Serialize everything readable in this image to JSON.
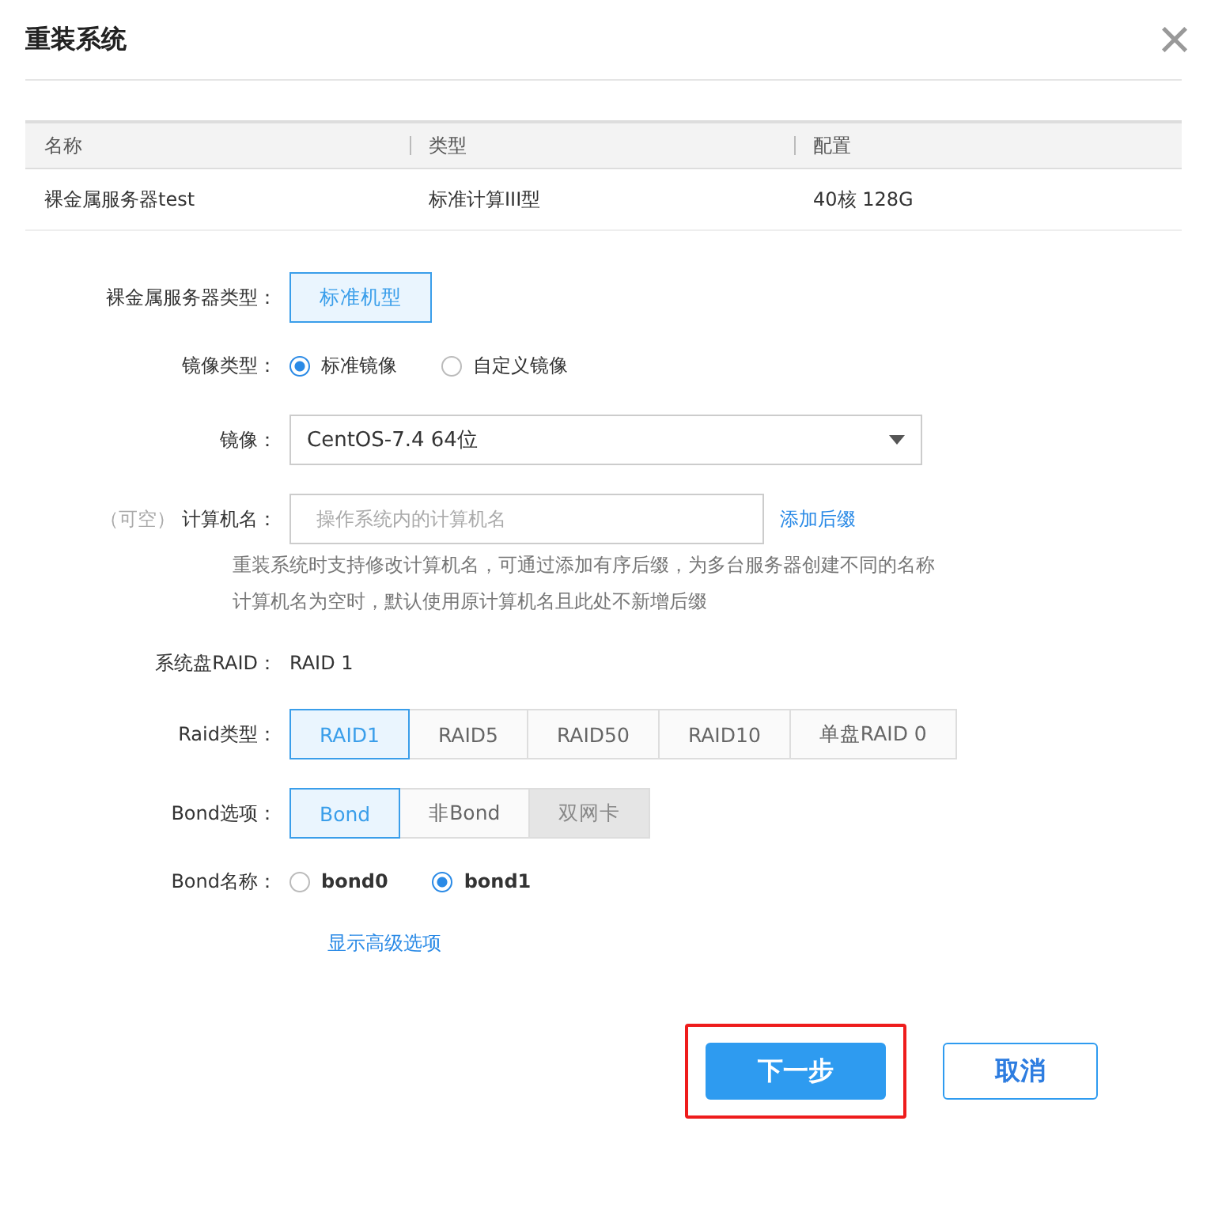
{
  "dialog": {
    "title": "重装系统",
    "close_icon": "×"
  },
  "table": {
    "columns": [
      "名称",
      "类型",
      "配置"
    ],
    "rows": [
      [
        "裸金属服务器test",
        "标准计算III型",
        "40核 128G"
      ]
    ]
  },
  "form": [
    {
      "kind": "buttons",
      "label": "裸金属服务器类型：",
      "options": [
        {
          "label": "标准机型",
          "selected": true,
          "disabled": false
        }
      ]
    },
    {
      "kind": "radios",
      "label": "镜像类型：",
      "bold": false,
      "options": [
        {
          "label": "标准镜像",
          "selected": true
        },
        {
          "label": "自定义镜像",
          "selected": false
        }
      ]
    },
    {
      "kind": "select",
      "label": "镜像：",
      "value": "CentOS-7.4 64位"
    },
    {
      "kind": "input",
      "optional": "（可空）",
      "label": "计算机名：",
      "placeholder": "操作系统内的计算机名",
      "link": "添加后缀",
      "help": [
        "重装系统时支持修改计算机名，可通过添加有序后缀，为多台服务器创建不同的名称",
        "计算机名为空时，默认使用原计算机名且此处不新增后缀"
      ]
    },
    {
      "kind": "text",
      "label": "系统盘RAID：",
      "value": "RAID 1"
    },
    {
      "kind": "buttons",
      "label": "Raid类型：",
      "options": [
        {
          "label": "RAID1",
          "selected": true,
          "disabled": false
        },
        {
          "label": "RAID5",
          "selected": false,
          "disabled": false
        },
        {
          "label": "RAID50",
          "selected": false,
          "disabled": false
        },
        {
          "label": "RAID10",
          "selected": false,
          "disabled": false
        },
        {
          "label": "单盘RAID 0",
          "selected": false,
          "disabled": false
        }
      ]
    },
    {
      "kind": "buttons",
      "label": "Bond选项：",
      "options": [
        {
          "label": "Bond",
          "selected": true,
          "disabled": false
        },
        {
          "label": "非Bond",
          "selected": false,
          "disabled": false
        },
        {
          "label": "双网卡",
          "selected": false,
          "disabled": true
        }
      ]
    },
    {
      "kind": "radios",
      "label": "Bond名称：",
      "bold": true,
      "options": [
        {
          "label": "bond0",
          "selected": false
        },
        {
          "label": "bond1",
          "selected": true
        }
      ]
    }
  ],
  "advanced_link": "显示高级选项",
  "buttons": [
    {
      "label": "下一步",
      "kind": "primary",
      "highlighted": true
    },
    {
      "label": "取消",
      "kind": "secondary",
      "highlighted": false
    }
  ]
}
